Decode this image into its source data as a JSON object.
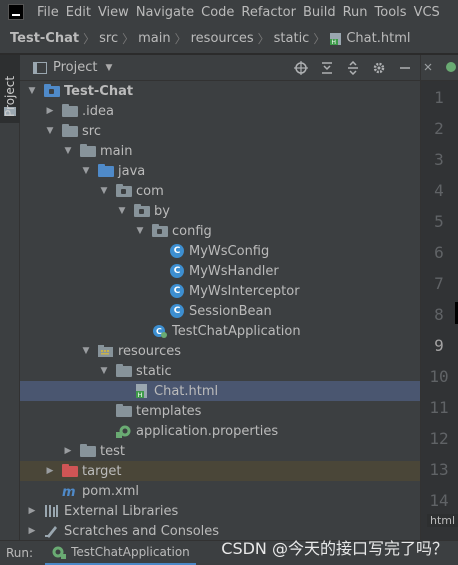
{
  "menubar": {
    "items": [
      "File",
      "Edit",
      "View",
      "Navigate",
      "Code",
      "Refactor",
      "Build",
      "Run",
      "Tools",
      "VCS"
    ]
  },
  "breadcrumb": {
    "project": "Test-Chat",
    "parts": [
      "src",
      "main",
      "resources",
      "static"
    ],
    "file": "Chat.html"
  },
  "stripe": {
    "project_tab": "Project"
  },
  "panel": {
    "title": "Project"
  },
  "tree": {
    "root": "Test-Chat",
    "idea": ".idea",
    "src": "src",
    "main": "main",
    "java": "java",
    "com": "com",
    "by": "by",
    "config": "config",
    "class1": "MyWsConfig",
    "class2": "MyWsHandler",
    "class3": "MyWsInterceptor",
    "class4": "SessionBean",
    "app": "TestChatApplication",
    "resources": "resources",
    "static": "static",
    "chat": "Chat.html",
    "templates": "templates",
    "props": "application.properties",
    "test": "test",
    "target": "target",
    "pom": "pom.xml",
    "libs": "External Libraries",
    "scratches": "Scratches and Consoles"
  },
  "gutter": {
    "lines": [
      "1",
      "2",
      "3",
      "4",
      "5",
      "6",
      "7",
      "8",
      "9",
      "10",
      "11",
      "12",
      "13",
      "14"
    ],
    "badge": "html"
  },
  "runbar": {
    "label": "Run:",
    "tab": "TestChatApplication"
  },
  "watermark": "CSDN @今天的接口写完了吗？",
  "colors": {
    "accent": "#4a88c7",
    "selection": "#4a5670",
    "folder_blue": "#4f8ac9",
    "class_icon": "#3d8fd1"
  }
}
